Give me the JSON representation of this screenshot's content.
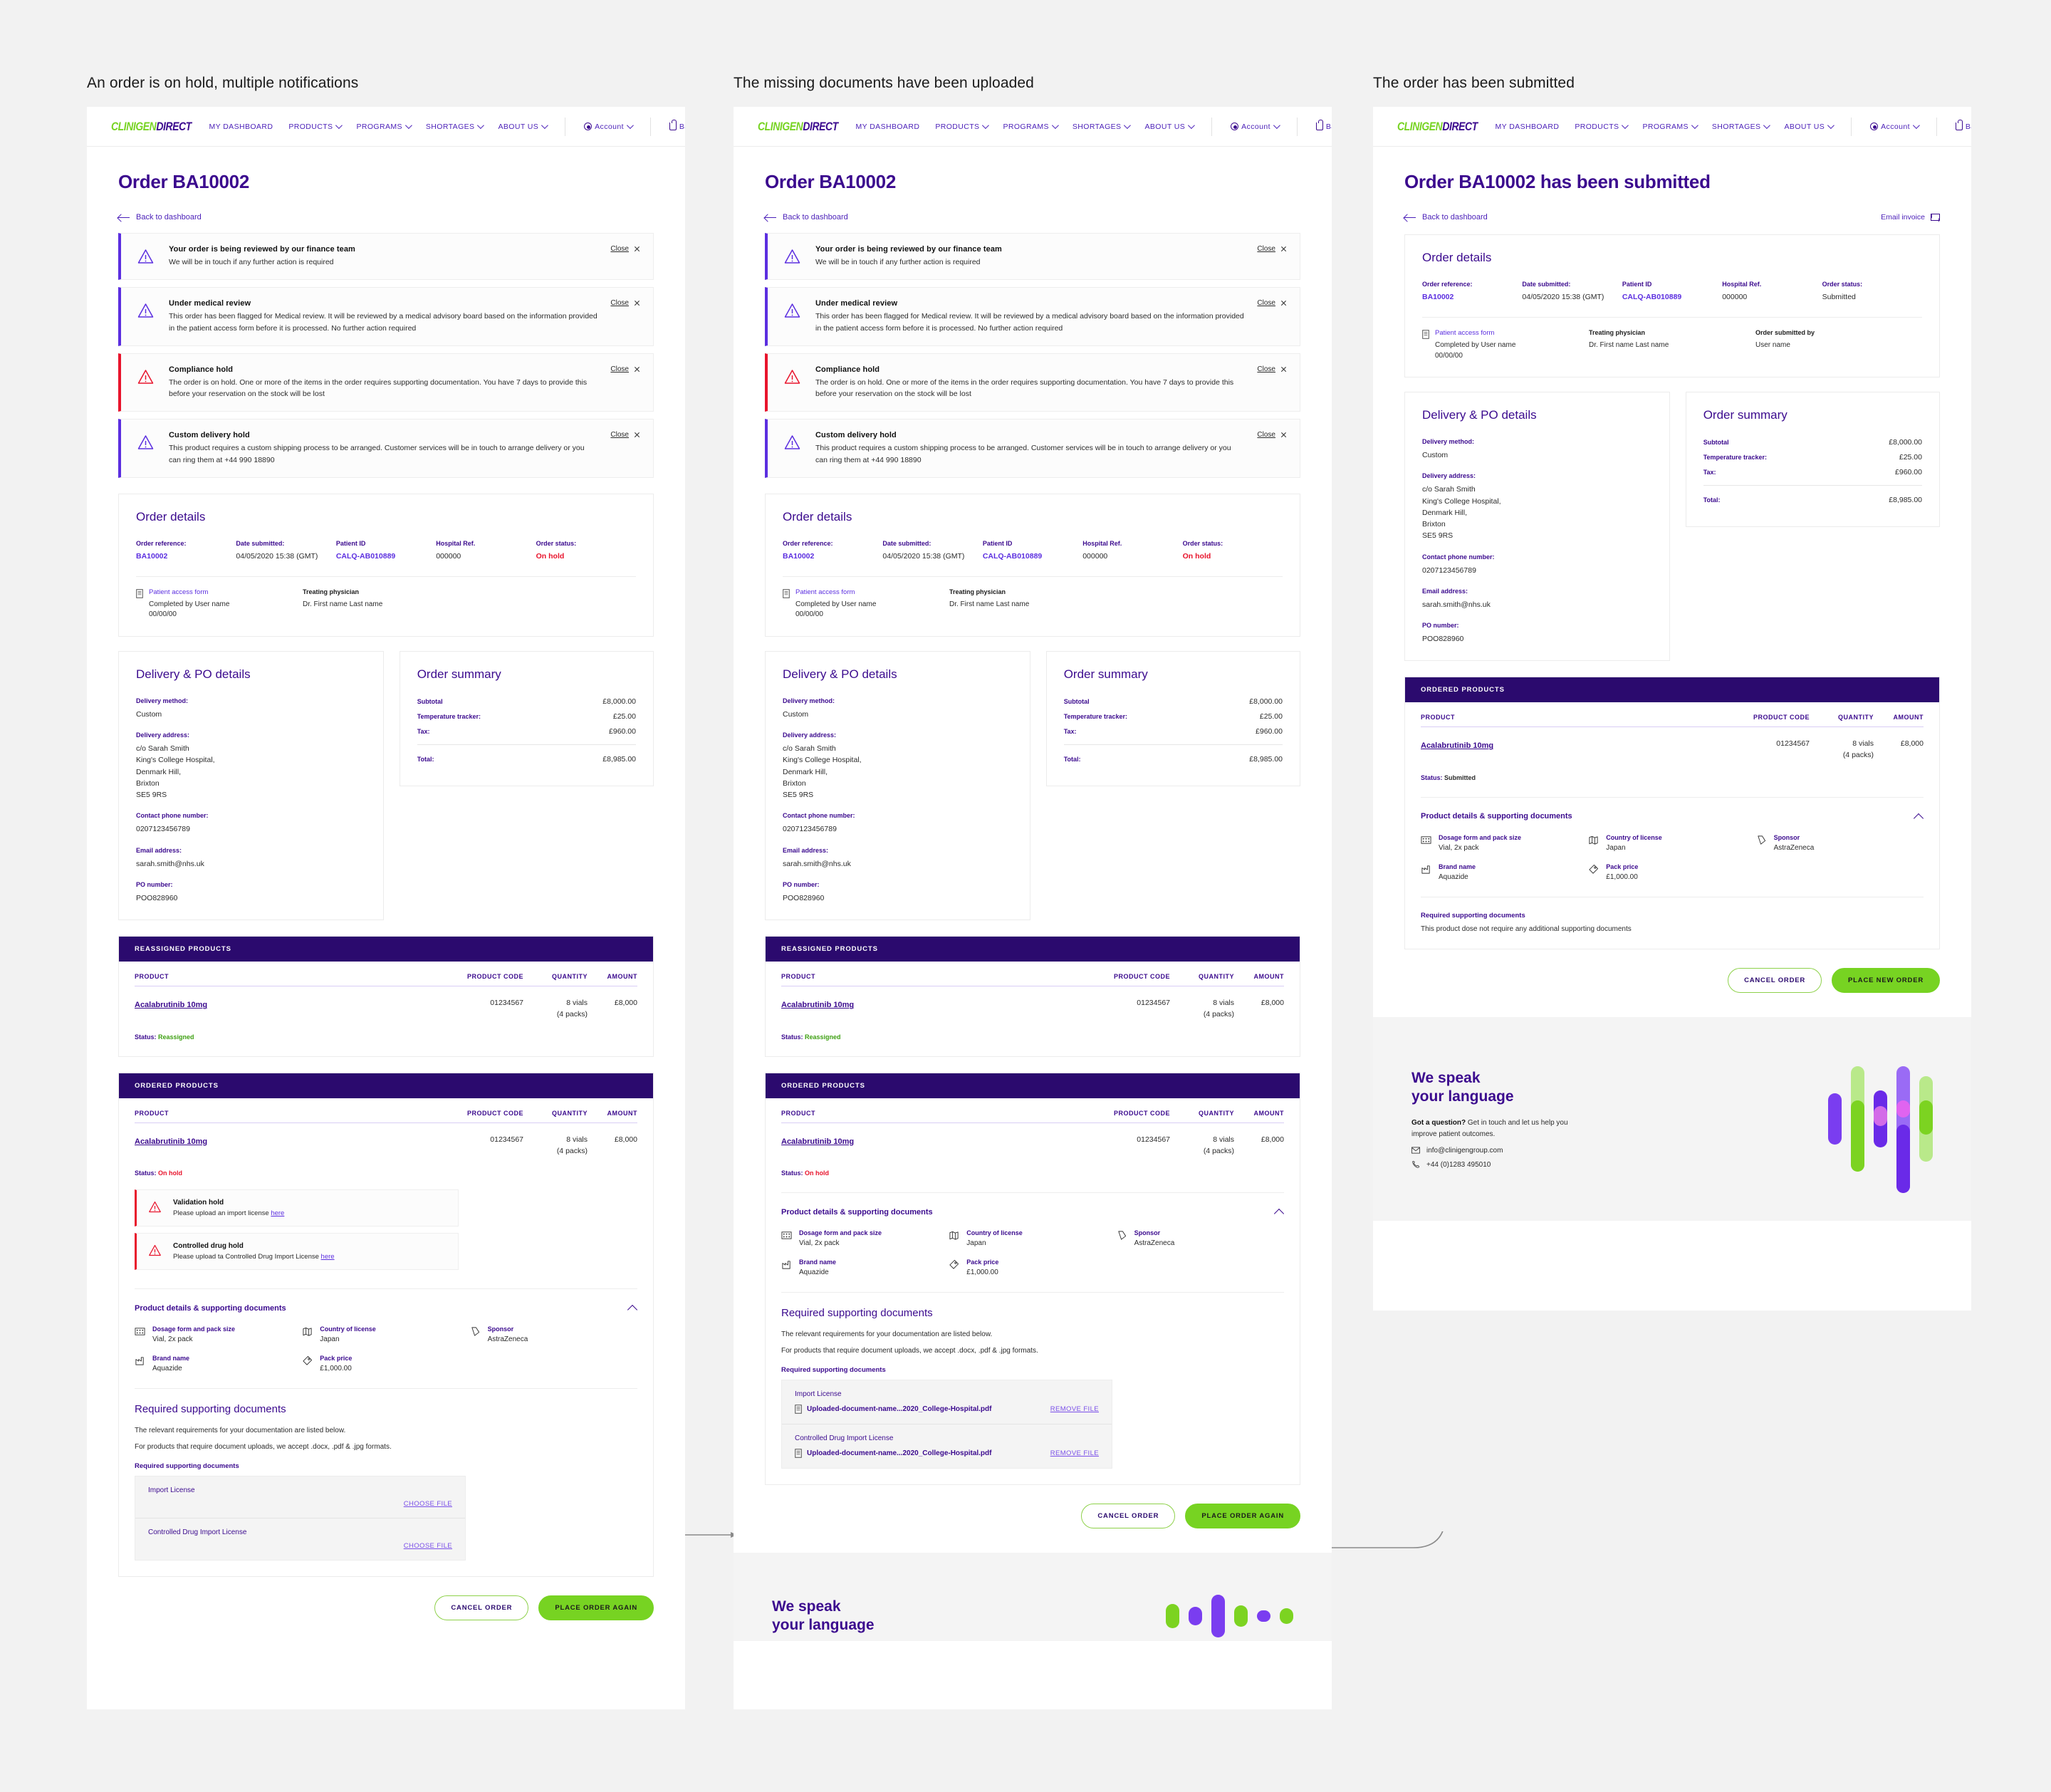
{
  "captions": {
    "p1": "An order is on hold, multiple notifications",
    "p2": "The missing documents have been uploaded",
    "p3": "The order has been submitted"
  },
  "nav": {
    "logo_a": "CLINIGEN",
    "logo_b": "DIRECT",
    "items": [
      {
        "label": "MY DASHBOARD",
        "caret": false
      },
      {
        "label": "PRODUCTS",
        "caret": true
      },
      {
        "label": "PROGRAMS",
        "caret": true
      },
      {
        "label": "SHORTAGES",
        "caret": true
      },
      {
        "label": "ABOUT US",
        "caret": true
      }
    ],
    "account": "Account",
    "basket": "Basket"
  },
  "page1": {
    "title": "Order BA10002",
    "back": "Back to dashboard",
    "alerts": [
      {
        "title": "Your order is being reviewed by our finance team",
        "text": "We will be in touch if any further action is required",
        "severity": "info",
        "close": "Close"
      },
      {
        "title": "Under medical review",
        "text": "This order has been flagged for Medical review. It will be reviewed by a medical advisory board based on the information provided in the patient access form before it is processed. No further action required",
        "severity": "info",
        "close": "Close"
      },
      {
        "title": "Compliance hold",
        "text": "The order is on hold.  One or more of the items in the order requires supporting documentation. You have 7 days to provide this before your reservation on the stock will be lost",
        "severity": "danger",
        "close": "Close"
      },
      {
        "title": "Custom delivery hold",
        "text": "This product requires a custom shipping process to be arranged.  Customer services will be in touch to arrange delivery or you can ring them at +44 990 18890",
        "severity": "info",
        "close": "Close"
      }
    ]
  },
  "page2": {
    "title": "Order BA10002",
    "back": "Back to dashboard"
  },
  "page3": {
    "title": "Order BA10002 has been submitted",
    "back": "Back to dashboard",
    "email_invoice": "Email invoice"
  },
  "order_details": {
    "heading": "Order details",
    "fields": [
      {
        "label": "Order reference:",
        "value": "BA10002",
        "style": "link"
      },
      {
        "label": "Date submitted:",
        "value": "04/05/2020 15:38 (GMT)",
        "style": "plain"
      },
      {
        "label": "Patient ID",
        "value": "CALQ-AB010889",
        "style": "link"
      },
      {
        "label": "Hospital Ref.",
        "value": "000000",
        "style": "plain"
      },
      {
        "label": "Order status:",
        "value": "On hold",
        "style": "red"
      }
    ],
    "status_submitted": "Submitted",
    "patient_access_form": "Patient access form",
    "completed_by": "Completed by User name",
    "completed_date": "00/00/00",
    "treating_physician_label": "Treating physician",
    "treating_physician": "Dr. First name Last name",
    "submitted_by_label": "Order submitted by",
    "submitted_by": "User name"
  },
  "delivery": {
    "heading": "Delivery & PO details",
    "method_label": "Delivery method:",
    "method": "Custom",
    "address_label": "Delivery address:",
    "address": "c/o Sarah Smith\nKing's College Hospital,\nDenmark Hill,\nBrixton\nSE5 9RS",
    "phone_label": "Contact phone number:",
    "phone": "0207123456789",
    "email_label": "Email address:",
    "email": "sarah.smith@nhs.uk",
    "po_label": "PO number:",
    "po": "POO828960"
  },
  "summary": {
    "heading": "Order summary",
    "rows": [
      {
        "label": "Subtotal",
        "amount": "£8,000.00"
      },
      {
        "label": "Temperature tracker:",
        "amount": "£25.00"
      },
      {
        "label": "Tax:",
        "amount": "£960.00"
      }
    ],
    "total_label": "Total:",
    "total_amount": "£8,985.00"
  },
  "tables": {
    "reassigned_header": "REASSIGNED PRODUCTS",
    "ordered_header": "ORDERED PRODUCTS",
    "columns": [
      "PRODUCT",
      "PRODUCT CODE",
      "QUANTITY",
      "AMOUNT"
    ],
    "product_name": "Acalabrutinib 10mg",
    "product_code": "01234567",
    "quantity": "8 vials",
    "quantity_sub": "(4 packs)",
    "amount": "£8,000",
    "status_label": "Status:",
    "status_reassigned": "Reassigned",
    "status_onhold": "On hold",
    "status_submitted": "Submitted"
  },
  "inline_holds": [
    {
      "title": "Validation hold",
      "text": "Please upload an import license ",
      "link": "here"
    },
    {
      "title": "Controlled drug hold",
      "text": "Please upload ta Controlled Drug Import License ",
      "link": "here"
    }
  ],
  "product_details": {
    "accordion_title": "Product details & supporting documents",
    "specs": [
      {
        "label": "Dosage form and pack size",
        "value": "Vial, 2x pack",
        "icon": "pack-icon"
      },
      {
        "label": "Country of license",
        "value": "Japan",
        "icon": "map-icon"
      },
      {
        "label": "Sponsor",
        "value": "AstraZeneca",
        "icon": "tag-icon"
      },
      {
        "label": "Brand name",
        "value": "Aquazide",
        "icon": "factory-icon"
      },
      {
        "label": "Pack price",
        "value": "£1,000.00",
        "icon": "price-tag-icon"
      }
    ],
    "rsd_heading": "Required supporting documents",
    "rsd_p1": "The relevant requirements for your documentation are listed below.",
    "rsd_p2": "For products that require document uploads, we accept .docx, .pdf & .jpg formats.",
    "rsd_label": "Required supporting documents",
    "no_docs": "This product dose not require any additional supporting documents",
    "docs_empty": [
      {
        "name": "Import License",
        "action": "CHOOSE FILE"
      },
      {
        "name": "Controlled Drug Import License",
        "action": "CHOOSE FILE"
      }
    ],
    "docs_uploaded": [
      {
        "name": "Import License",
        "file": "Uploaded-document-name...2020_College-Hospital.pdf",
        "action": "REMOVE FILE"
      },
      {
        "name": "Controlled Drug Import License",
        "file": "Uploaded-document-name...2020_College-Hospital.pdf",
        "action": "REMOVE FILE"
      }
    ]
  },
  "buttons": {
    "cancel": "CANCEL ORDER",
    "place_again": "PLACE ORDER AGAIN",
    "place_new": "PLACE NEW ORDER"
  },
  "promo": {
    "line1": "We speak",
    "line2": "your language",
    "q_bold": "Got a question?",
    "q_rest": " Get in touch and let us help you improve patient outcomes.",
    "email": "info@clinigengroup.com",
    "phone": "+44 (0)1283 495010"
  },
  "colors": {
    "purple": "#3b0a8e",
    "violet": "#5b2ee0",
    "green": "#77d322",
    "red": "#e8142c",
    "dark_purple": "#2b0a6e"
  }
}
